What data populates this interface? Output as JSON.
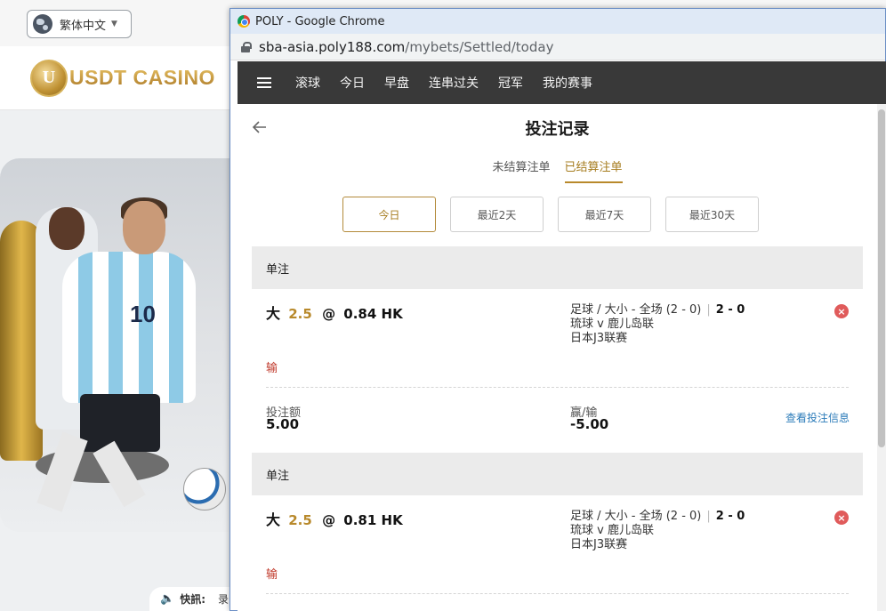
{
  "background": {
    "lang_label": "繁体中文",
    "logo_text": "USDT CASINO",
    "jersey_number": "10",
    "news_label": "快訊:",
    "news_tail": "录"
  },
  "window": {
    "title": "POLY - Google Chrome",
    "url_host": "sba-asia.poly188.com",
    "url_path": "/mybets/Settled/today"
  },
  "nav": {
    "items": [
      "滚球",
      "今日",
      "早盘",
      "连串过关",
      "冠军",
      "我的赛事"
    ]
  },
  "page": {
    "title": "投注记录",
    "tabs": [
      "未结算注单",
      "已结算注单"
    ],
    "active_tab": 1,
    "filters": [
      "今日",
      "最近2天",
      "最近7天",
      "最近30天"
    ],
    "active_filter": 0
  },
  "bets": [
    {
      "type_label": "单注",
      "pick": "大",
      "line": "2.5",
      "at": "@",
      "odds": "0.84 HK",
      "market": "足球 / 大小 - 全场 (2 - 0)",
      "sep": "|",
      "score": "2 - 0",
      "teams": "琉球 v 鹿儿岛联",
      "league": "日本J3联赛",
      "result": "输",
      "stake_label": "投注额",
      "stake": "5.00",
      "winloss_label": "赢/输",
      "winloss": "-5.00",
      "link": "查看投注信息"
    },
    {
      "type_label": "单注",
      "pick": "大",
      "line": "2.5",
      "at": "@",
      "odds": "0.81 HK",
      "market": "足球 / 大小 - 全场 (2 - 0)",
      "sep": "|",
      "score": "2 - 0",
      "teams": "琉球 v 鹿儿岛联",
      "league": "日本J3联赛",
      "result": "输"
    }
  ],
  "colors": {
    "accent_gold": "#b8892b",
    "nav_bg": "#393939",
    "loss_red": "#c0392b",
    "link_blue": "#2b7bb9"
  }
}
